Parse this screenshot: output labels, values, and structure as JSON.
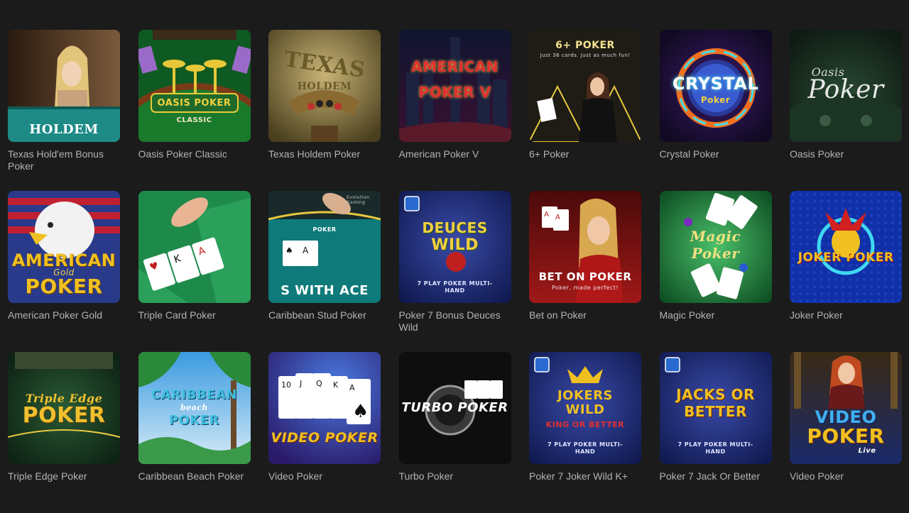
{
  "games": [
    {
      "title": "Texas Hold'em Bonus Poker",
      "art": "HOLDEM"
    },
    {
      "title": "Oasis Poker Classic",
      "art": "OASIS POKER",
      "art2": "CLASSIC"
    },
    {
      "title": "Texas Holdem Poker",
      "art": "TEXAS",
      "art2": "HOLDEM"
    },
    {
      "title": "American Poker V",
      "art": "AMERICAN",
      "art2": "POKER V"
    },
    {
      "title": "6+ Poker",
      "art": "6+ POKER",
      "art2": "Just 36 cards. Just as much fun!"
    },
    {
      "title": "Crystal Poker",
      "art": "CRYSTAL",
      "art2": "Poker"
    },
    {
      "title": "Oasis Poker",
      "art": "Oasis",
      "art2": "Poker"
    },
    {
      "title": "American Poker Gold",
      "art": "AMERICAN",
      "art2": "POKER",
      "art3": "Gold"
    },
    {
      "title": "Triple Card Poker",
      "art": "",
      "art2": ""
    },
    {
      "title": "Caribbean Stud Poker",
      "art": "S WITH ACE",
      "art2": "POKER",
      "art3": "Evolution Gaming"
    },
    {
      "title": "Poker 7 Bonus Deuces Wild",
      "art": "DEUCES",
      "art2": "WILD",
      "art3": "7 PLAY POKER MULTI-HAND"
    },
    {
      "title": "Bet on Poker",
      "art": "BET ON POKER",
      "art2": "Poker, made perfect!"
    },
    {
      "title": "Magic Poker",
      "art": "Magic",
      "art2": "Poker"
    },
    {
      "title": "Joker Poker",
      "art": "JOKER POKER",
      "art2": ""
    },
    {
      "title": "Triple Edge Poker",
      "art": "Triple Edge",
      "art2": "POKER"
    },
    {
      "title": "Caribbean Beach Poker",
      "art": "CARIBBEAN",
      "art2": "POKER",
      "art3": "beach"
    },
    {
      "title": "Video Poker",
      "art": "VIDEO POKER",
      "art2": ""
    },
    {
      "title": "Turbo Poker",
      "art": "TURBO POKER",
      "art2": ""
    },
    {
      "title": "Poker 7 Joker Wild K+",
      "art": "JOKERS WILD",
      "art2": "KING OR BETTER",
      "art3": "7 PLAY POKER MULTI-HAND"
    },
    {
      "title": "Poker 7 Jack Or Better",
      "art": "JACKS OR BETTER",
      "art2": "7 PLAY POKER MULTI-HAND"
    },
    {
      "title": "Video Poker",
      "art": "VIDEO",
      "art2": "POKER",
      "art3": "Live"
    }
  ]
}
